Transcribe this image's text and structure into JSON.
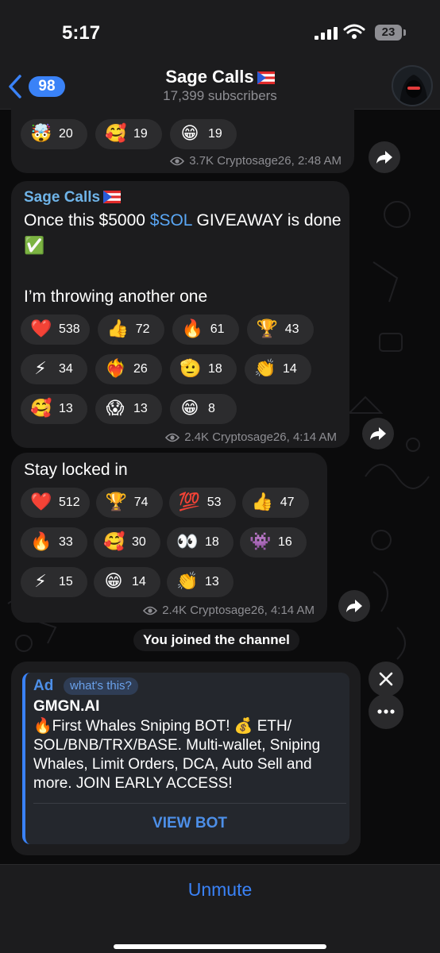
{
  "status_bar": {
    "time": "5:17",
    "battery": "23"
  },
  "header": {
    "back_count": "98",
    "title": "Sage Calls",
    "subtitle": "17,399 subscribers"
  },
  "messages": [
    {
      "reactions": [
        {
          "emoji": "🤯",
          "count": "20"
        },
        {
          "emoji": "🥰",
          "count": "19"
        },
        {
          "emoji": "😁",
          "count": "19"
        }
      ],
      "meta": "3.7K Cryptosage26, 2:48 AM"
    },
    {
      "sender": "Sage Calls",
      "text_before": "Once this $5000 ",
      "text_link": "$SOL",
      "text_after": " GIVEAWAY is done ✅",
      "text_line2": "I’m throwing another one",
      "reactions": [
        {
          "emoji": "❤️",
          "count": "538"
        },
        {
          "emoji": "👍",
          "count": "72"
        },
        {
          "emoji": "🔥",
          "count": "61"
        },
        {
          "emoji": "🏆",
          "count": "43"
        },
        {
          "emoji": "⚡",
          "count": "34"
        },
        {
          "emoji": "❤️‍🔥",
          "count": "26"
        },
        {
          "emoji": "🫡",
          "count": "18"
        },
        {
          "emoji": "👏",
          "count": "14"
        },
        {
          "emoji": "🥰",
          "count": "13"
        },
        {
          "emoji": "😱",
          "count": "13"
        },
        {
          "emoji": "😁",
          "count": "8"
        }
      ],
      "meta": "2.4K Cryptosage26, 4:14 AM"
    },
    {
      "text": "Stay locked in",
      "reactions": [
        {
          "emoji": "❤️",
          "count": "512"
        },
        {
          "emoji": "🏆",
          "count": "74"
        },
        {
          "emoji": "💯",
          "count": "53"
        },
        {
          "emoji": "👍",
          "count": "47"
        },
        {
          "emoji": "🔥",
          "count": "33"
        },
        {
          "emoji": "🥰",
          "count": "30"
        },
        {
          "emoji": "👀",
          "count": "18"
        },
        {
          "emoji": "👾",
          "count": "16"
        },
        {
          "emoji": "⚡",
          "count": "15"
        },
        {
          "emoji": "😁",
          "count": "14"
        },
        {
          "emoji": "👏",
          "count": "13"
        }
      ],
      "meta": "2.4K Cryptosage26, 4:14 AM"
    }
  ],
  "service_message": "You joined the channel",
  "ad": {
    "tag": "Ad",
    "whats_this": "what's this?",
    "title": "GMGN.AI",
    "body": "🔥First Whales Sniping BOT! 💰 ETH/ SOL/BNB/TRX/BASE. Multi-wallet, Sniping Whales, Limit Orders, DCA, Auto Sell and more. JOIN EARLY ACCESS!",
    "button": "VIEW BOT"
  },
  "footer": {
    "unmute": "Unmute"
  },
  "colors": {
    "accent": "#3a82f7",
    "sender": "#6fb4e8",
    "bubble": "#1c1c1e"
  }
}
